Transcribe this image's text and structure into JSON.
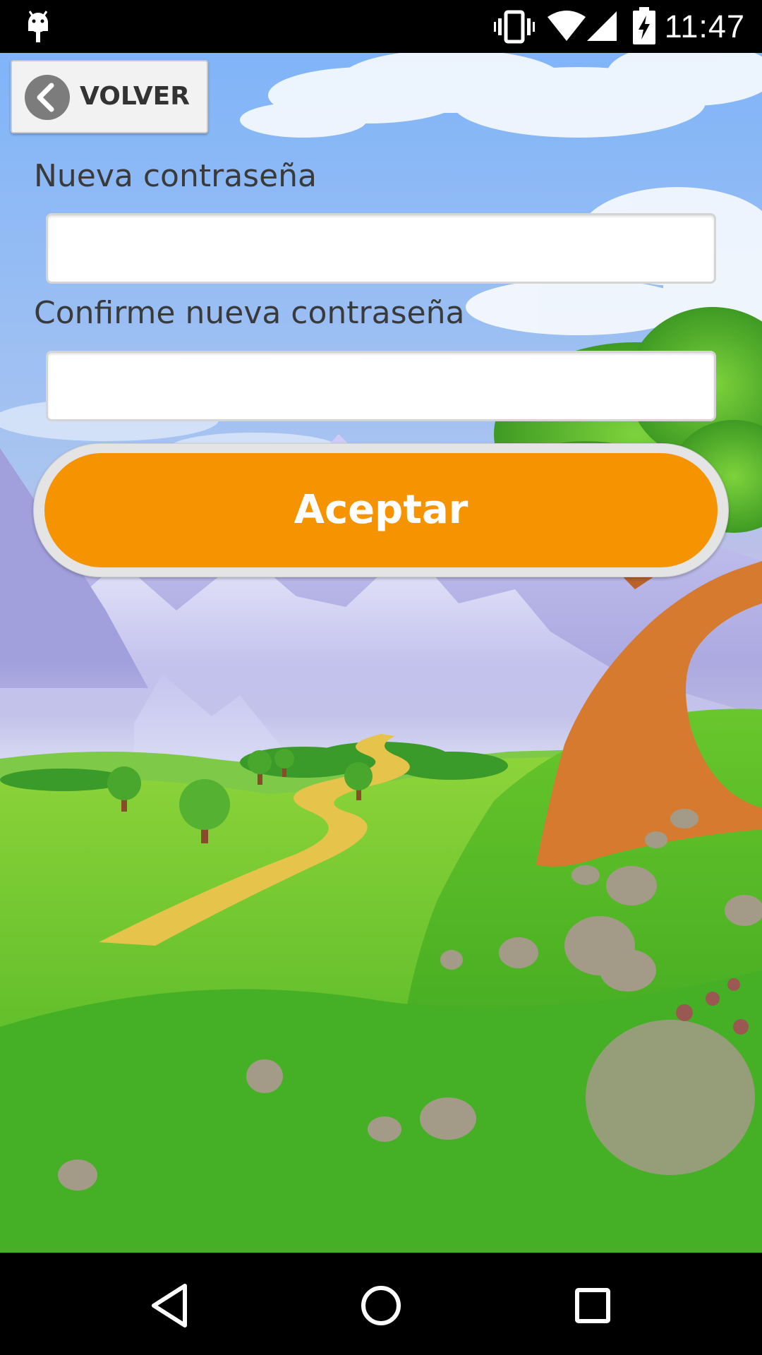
{
  "status_bar": {
    "time": "11:47",
    "icons": [
      "android-debug-icon",
      "vibrate-icon",
      "wifi-icon",
      "signal-icon",
      "battery-charging-icon"
    ]
  },
  "back_button": {
    "label": "VOLVER",
    "icon": "chevron-left-icon"
  },
  "form": {
    "new_password_label": "Nueva contraseña",
    "new_password_value": "",
    "confirm_password_label": "Confirme nueva contraseña",
    "confirm_password_value": ""
  },
  "accept_button": {
    "label": "Aceptar",
    "color": "#f59400"
  },
  "nav_bar": {
    "icons": [
      "back-triangle-icon",
      "home-circle-icon",
      "recents-square-icon"
    ]
  }
}
